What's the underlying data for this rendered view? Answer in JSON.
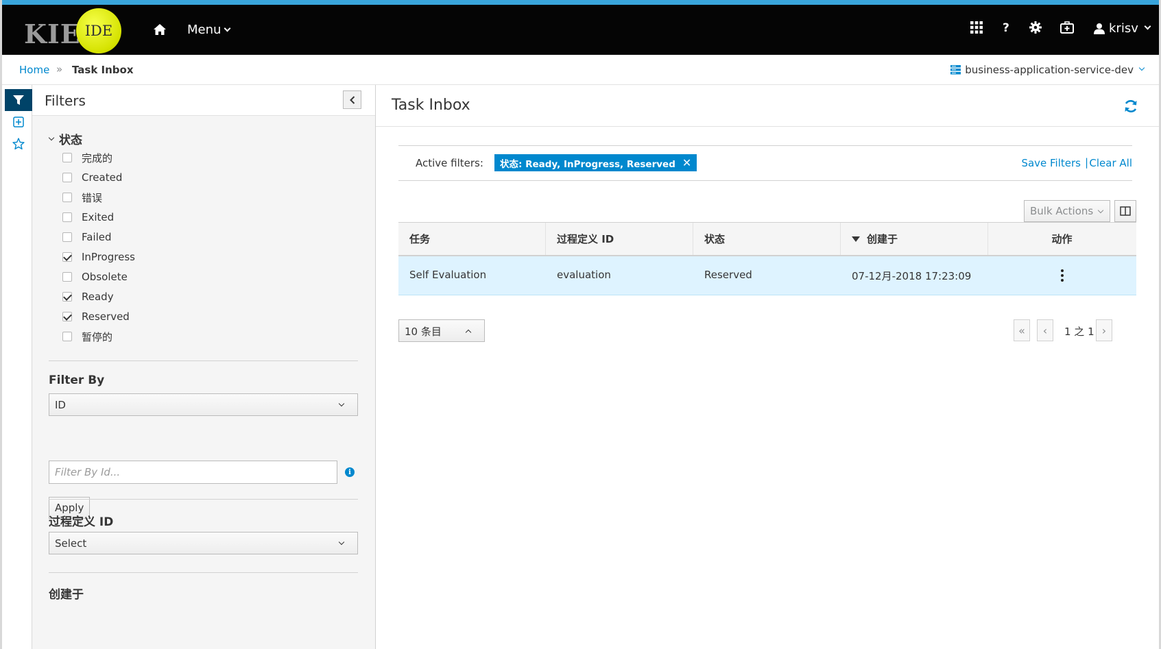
{
  "header": {
    "logo_text": "KIE",
    "logo_badge": "IDE",
    "menu_label": "Menu",
    "help_label": "?",
    "user_name": "krisv",
    "accent_color": "#39a5dc"
  },
  "breadcrumb": {
    "home": "Home",
    "separator": "»",
    "current": "Task Inbox",
    "server": "business-application-service-dev"
  },
  "rail": {
    "icons": [
      "filter-icon",
      "add-square-icon",
      "star-icon"
    ]
  },
  "filters": {
    "title": "Filters",
    "status_group": {
      "title": "状态",
      "options": [
        {
          "label": "完成的",
          "checked": false
        },
        {
          "label": "Created",
          "checked": false
        },
        {
          "label": "错误",
          "checked": false
        },
        {
          "label": "Exited",
          "checked": false
        },
        {
          "label": "Failed",
          "checked": false
        },
        {
          "label": "InProgress",
          "checked": true
        },
        {
          "label": "Obsolete",
          "checked": false
        },
        {
          "label": "Ready",
          "checked": true
        },
        {
          "label": "Reserved",
          "checked": true
        },
        {
          "label": "暂停的",
          "checked": false
        }
      ]
    },
    "filter_by": {
      "label": "Filter By",
      "selected": "ID",
      "input_placeholder": "Filter By Id...",
      "apply_label": "Apply"
    },
    "process_def": {
      "label": "过程定义 ID",
      "selected": "Select"
    },
    "created_on": {
      "label": "创建于"
    }
  },
  "main": {
    "title": "Task Inbox",
    "active_filters_label": "Active filters:",
    "active_filter_chip": "状态: Ready, InProgress, Reserved",
    "chip_remove": "✕",
    "save_filters": "Save Filters",
    "link_separator": "|",
    "clear_all": "Clear All",
    "bulk_actions": "Bulk Actions",
    "columns": [
      "任务",
      "过程定义 ID",
      "状态",
      "创建于",
      "动作"
    ],
    "rows": [
      {
        "task": "Self Evaluation",
        "process": "evaluation",
        "status": "Reserved",
        "created": "07-12月-2018 17:23:09"
      }
    ],
    "page_size": "10 条目",
    "pagination": {
      "first": "«",
      "prev": "‹",
      "text": "1 之 1",
      "next": "›"
    }
  }
}
